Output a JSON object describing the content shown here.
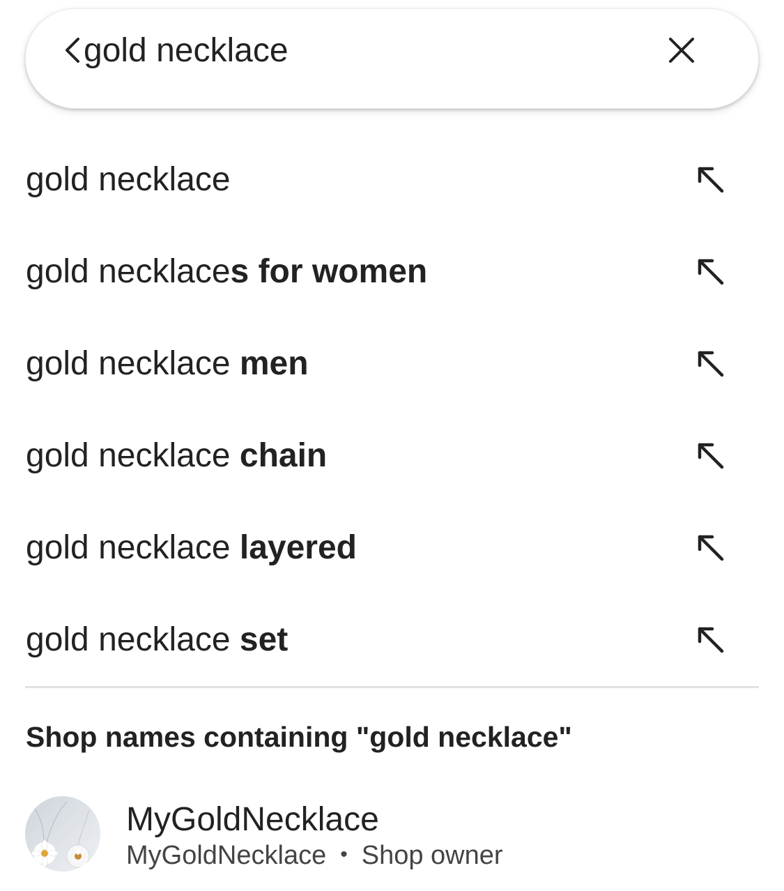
{
  "search": {
    "query": "gold necklace",
    "back_icon": "chevron-left-icon",
    "clear_icon": "close-icon"
  },
  "suggestions": [
    {
      "prefix": "gold necklace",
      "suffix": ""
    },
    {
      "prefix": "gold necklace",
      "suffix": "s for women"
    },
    {
      "prefix": "gold necklace ",
      "suffix": "men"
    },
    {
      "prefix": "gold necklace ",
      "suffix": "chain"
    },
    {
      "prefix": "gold necklace ",
      "suffix": "layered"
    },
    {
      "prefix": "gold necklace ",
      "suffix": "set"
    }
  ],
  "shops_section": {
    "heading": "Shop names containing \"gold necklace\"",
    "shops": [
      {
        "name": "MyGoldNecklace",
        "owner": "MyGoldNecklace",
        "separator": "•",
        "role": "Shop owner"
      }
    ]
  }
}
